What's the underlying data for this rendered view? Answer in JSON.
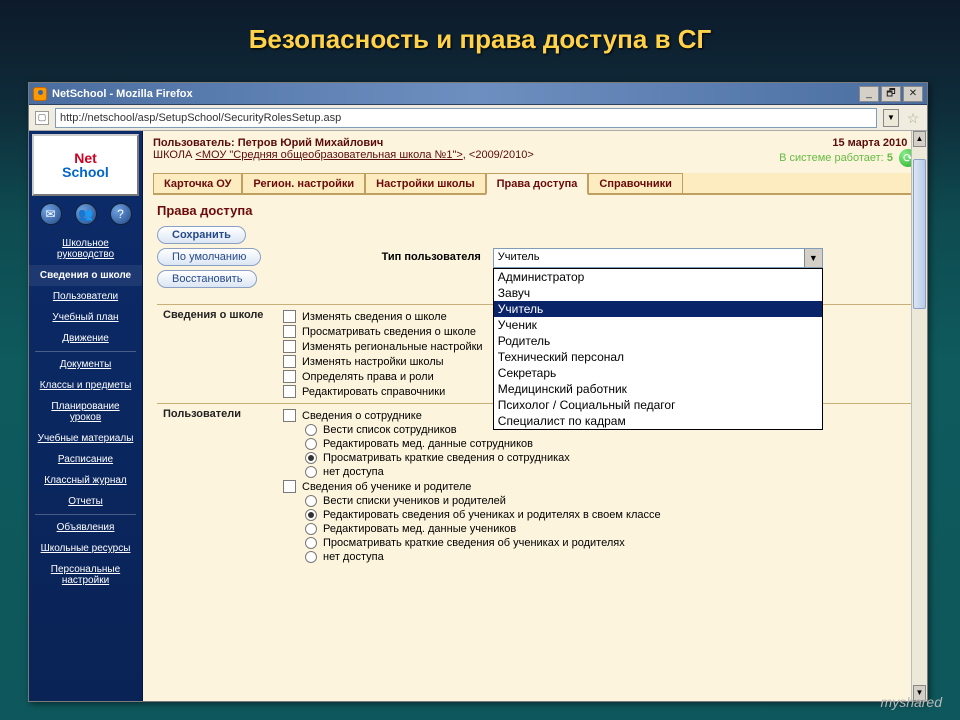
{
  "slide_title": "Безопасность и права доступа в СГ",
  "browser": {
    "title": "NetSchool - Mozilla Firefox",
    "url": "http://netschool/asp/SetupSchool/SecurityRolesSetup.asp",
    "win_min": "_",
    "win_max": "🗗",
    "win_close": "✕"
  },
  "logo": {
    "line1": "Net",
    "line2": "School"
  },
  "header": {
    "user_label": "Пользователь:",
    "user_name": "Петров Юрий Михайлович",
    "school_label": "ШКОЛА",
    "school_link": "<МОУ \"Средняя общеобразовательная школа №1\">",
    "year": ", <2009/2010>",
    "date": "15 марта 2010 г.",
    "online_label": "В системе работает:",
    "online_count": "5"
  },
  "tabs": [
    {
      "label": "Карточка ОУ"
    },
    {
      "label": "Регион. настройки"
    },
    {
      "label": "Настройки школы"
    },
    {
      "label": "Права доступа"
    },
    {
      "label": "Справочники"
    }
  ],
  "active_tab": 3,
  "page_heading": "Права доступа",
  "buttons": {
    "save": "Сохранить",
    "default": "По умолчанию",
    "restore": "Восстановить"
  },
  "user_type_label": "Тип пользователя",
  "user_type_selected": "Учитель",
  "user_type_options": [
    "Администратор",
    "Завуч",
    "Учитель",
    "Ученик",
    "Родитель",
    "Технический персонал",
    "Секретарь",
    "Медицинский работник",
    "Психолог / Социальный педагог",
    "Специалист по кадрам"
  ],
  "user_type_highlight_index": 2,
  "sidebar": {
    "icons": [
      "✉",
      "👥",
      "?"
    ],
    "items": [
      "Школьное руководство",
      "Сведения о школе",
      "Пользователи",
      "Учебный план",
      "Движение",
      "Документы",
      "Классы и предметы",
      "Планирование уроков",
      "Учебные материалы",
      "Расписание",
      "Классный журнал",
      "Отчеты",
      "Объявления",
      "Школьные ресурсы",
      "Персональные настройки"
    ],
    "active_index": 1,
    "sep_after": [
      4,
      11
    ]
  },
  "groups": [
    {
      "title": "Сведения о школе",
      "rows": [
        {
          "type": "checkbox",
          "label": "Изменять сведения о школе"
        },
        {
          "type": "checkbox",
          "label": "Просматривать сведения о школе"
        },
        {
          "type": "checkbox",
          "label": "Изменять региональные настройки"
        },
        {
          "type": "checkbox",
          "label": "Изменять настройки школы"
        },
        {
          "type": "checkbox",
          "label": "Определять права и роли"
        },
        {
          "type": "checkbox",
          "label": "Редактировать справочники"
        }
      ]
    },
    {
      "title": "Пользователи",
      "rows": [
        {
          "type": "checkbox",
          "label": "Сведения о сотруднике"
        },
        {
          "type": "radio",
          "label": "Вести список сотрудников",
          "sub": true
        },
        {
          "type": "radio",
          "label": "Редактировать мед. данные сотрудников",
          "sub": true
        },
        {
          "type": "radio",
          "label": "Просматривать краткие сведения о сотрудниках",
          "sub": true,
          "checked": true
        },
        {
          "type": "radio",
          "label": "нет доступа",
          "sub": true
        },
        {
          "type": "checkbox",
          "label": "Сведения об ученике и родителе"
        },
        {
          "type": "radio",
          "label": "Вести списки учеников и родителей",
          "sub": true
        },
        {
          "type": "radio",
          "label": "Редактировать сведения об учениках и родителях в своем классе",
          "sub": true,
          "checked": true
        },
        {
          "type": "radio",
          "label": "Редактировать мед. данные учеников",
          "sub": true
        },
        {
          "type": "radio",
          "label": "Просматривать краткие сведения об учениках и родителях",
          "sub": true
        },
        {
          "type": "radio",
          "label": "нет доступа",
          "sub": true
        }
      ]
    }
  ],
  "watermark": "myshared"
}
